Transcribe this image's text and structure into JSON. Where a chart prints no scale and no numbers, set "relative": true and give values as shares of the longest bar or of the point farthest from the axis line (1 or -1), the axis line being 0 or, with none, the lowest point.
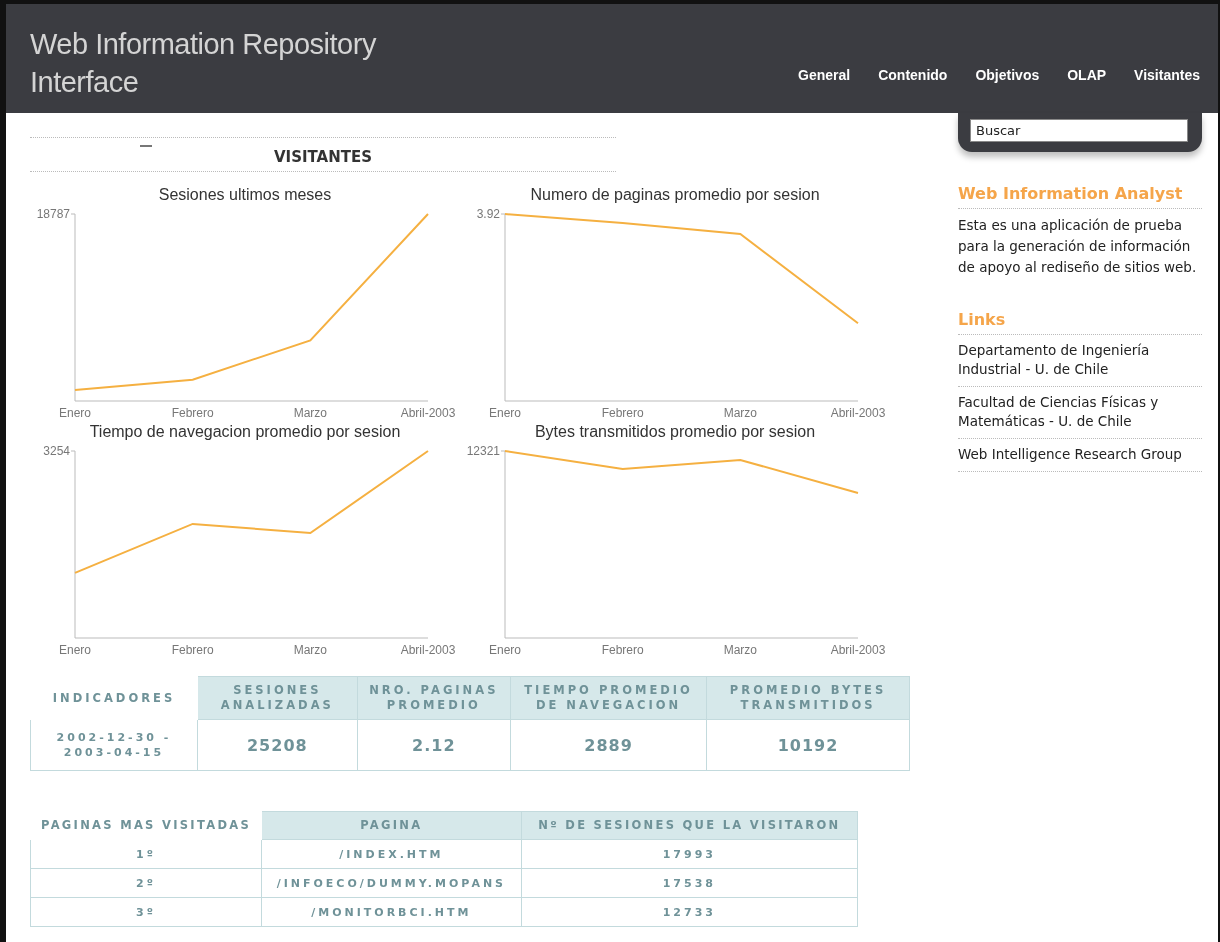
{
  "header": {
    "title": "Web Information Repository Interface",
    "nav": [
      {
        "label": "General",
        "selected": false
      },
      {
        "label": "Contenido",
        "selected": false
      },
      {
        "label": "Objetivos",
        "selected": false
      },
      {
        "label": "OLAP",
        "selected": false
      },
      {
        "label": "Visitantes",
        "selected": false
      }
    ]
  },
  "search": {
    "placeholder": "Buscar"
  },
  "section": {
    "title": "VISITANTES"
  },
  "charts": [
    {
      "chart_data": {
        "type": "line",
        "title": "Sesiones ultimos meses",
        "relative": true,
        "categories": [
          "Enero",
          "Febrero",
          "Marzo",
          "Abril-2003"
        ],
        "series": [
          {
            "color": "#f5b041",
            "values": [
              0.059,
              0.114,
              0.324,
              1
            ]
          }
        ],
        "annotations": [
          {
            "text": "18787"
          }
        ]
      }
    },
    {
      "chart_data": {
        "type": "line",
        "title": "Numero de paginas promedio por sesion",
        "relative": true,
        "categories": [
          "Enero",
          "Febrero",
          "Marzo",
          "Abril-2003"
        ],
        "series": [
          {
            "color": "#f5b041",
            "values": [
              1,
              0.952,
              0.893,
              0.416
            ]
          }
        ],
        "annotations": [
          {
            "text": "3.92"
          }
        ]
      }
    },
    {
      "chart_data": {
        "type": "line",
        "title": "Tiempo de navegacion promedio por sesion",
        "relative": true,
        "categories": [
          "Enero",
          "Febrero",
          "Marzo",
          "Abril-2003"
        ],
        "series": [
          {
            "color": "#f5b041",
            "values": [
              0.348,
              0.61,
              0.561,
              1
            ]
          }
        ],
        "annotations": [
          {
            "text": "3254"
          }
        ]
      }
    },
    {
      "chart_data": {
        "type": "line",
        "title": "Bytes transmitidos promedio por sesion",
        "relative": true,
        "categories": [
          "Enero",
          "Febrero",
          "Marzo",
          "Abril-2003"
        ],
        "series": [
          {
            "color": "#f5b041",
            "values": [
              1,
              0.904,
              0.952,
              0.775
            ]
          }
        ],
        "annotations": [
          {
            "text": "12321"
          }
        ]
      }
    }
  ],
  "indicators": {
    "columns": [
      "INDICADORES",
      "SESIONES ANALIZADAS",
      "NRO. PAGINAS PROMEDIO",
      "TIEMPO PROMEDIO DE NAVEGACION",
      "PROMEDIO BYTES TRANSMITIDOS"
    ],
    "row": [
      "2002-12-30 - 2003-04-15",
      "25208",
      "2.12",
      "2889",
      "10192"
    ]
  },
  "top_pages": {
    "columns": [
      "PAGINAS MAS VISITADAS",
      "PAGINA",
      "Nº DE SESIONES QUE LA VISITARON"
    ],
    "rows": [
      [
        "1º",
        "/INDEX.HTM",
        "17993"
      ],
      [
        "2º",
        "/INFOECO/DUMMY.MOPANS",
        "17538"
      ],
      [
        "3º",
        "/MONITORBCI.HTM",
        "12733"
      ]
    ]
  },
  "sidebar": {
    "about_title": "Web Information Analyst",
    "about_text": "Esta es una aplicación de prueba para la generación de información de apoyo al rediseño de sitios web.",
    "links_title": "Links",
    "links": [
      "Departamento de Ingeniería Industrial - U. de Chile",
      "Facultad de Ciencias Físicas y Matemáticas - U. de Chile",
      "Web Intelligence Research Group"
    ]
  }
}
